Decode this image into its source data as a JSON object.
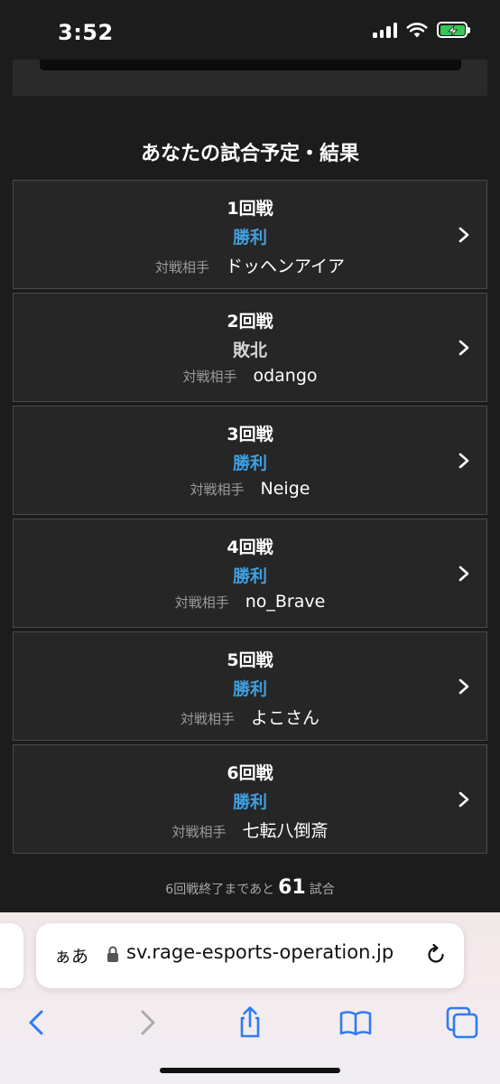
{
  "status_bar": {
    "time": "3:52",
    "icons": [
      "cellular-signal-icon",
      "wifi-icon",
      "battery-charging-icon"
    ]
  },
  "page": {
    "section_title": "あなたの試合予定・結果",
    "matches": [
      {
        "round": "1回戦",
        "result": "勝利",
        "result_type": "win",
        "opponent_label": "対戦相手",
        "opponent": "ドッヘンアイア"
      },
      {
        "round": "2回戦",
        "result": "敗北",
        "result_type": "loss",
        "opponent_label": "対戦相手",
        "opponent": "odango"
      },
      {
        "round": "3回戦",
        "result": "勝利",
        "result_type": "win",
        "opponent_label": "対戦相手",
        "opponent": "Neige"
      },
      {
        "round": "4回戦",
        "result": "勝利",
        "result_type": "win",
        "opponent_label": "対戦相手",
        "opponent": "no_Brave"
      },
      {
        "round": "5回戦",
        "result": "勝利",
        "result_type": "win",
        "opponent_label": "対戦相手",
        "opponent": "よこさん"
      },
      {
        "round": "6回戦",
        "result": "勝利",
        "result_type": "win",
        "opponent_label": "対戦相手",
        "opponent": "七転八倒斎"
      }
    ],
    "remaining": {
      "prefix": "6回戦終了まであと",
      "count": "61",
      "suffix": "試合"
    }
  },
  "browser": {
    "aa_label": "ぁあ",
    "url": "sv.rage-esports-operation.jp",
    "toolbar_icons": [
      "back-icon",
      "forward-icon",
      "share-icon",
      "bookmarks-icon",
      "tabs-icon"
    ]
  },
  "colors": {
    "background": "#1c1c1c",
    "card": "#262626",
    "win": "#3f9fe0",
    "loss": "#d6d6d6",
    "ios_blue": "#2f7bf5"
  }
}
